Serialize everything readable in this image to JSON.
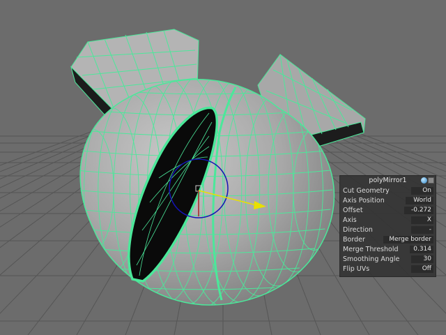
{
  "panel": {
    "title": "polyMirror1",
    "rows": [
      {
        "label": "Cut Geometry",
        "value": "On"
      },
      {
        "label": "Axis Position",
        "value": "World"
      },
      {
        "label": "Offset",
        "value": "-0.272"
      },
      {
        "label": "Axis",
        "value": "X"
      },
      {
        "label": "Direction",
        "value": "-"
      },
      {
        "label": "Border",
        "value": "Merge border"
      },
      {
        "label": "Merge Threshold",
        "value": "0.314"
      },
      {
        "label": "Smoothing Angle",
        "value": "30"
      },
      {
        "label": "Flip UVs",
        "value": "Off"
      }
    ]
  },
  "icons": {
    "help": "help-icon",
    "close": "close-icon"
  },
  "colors": {
    "viewport_bg": "#6c6c6c",
    "grid": "#585858",
    "wireframe": "#4be89a",
    "mesh_fill": "#a2a2a2",
    "manip_circle": "#1414b4",
    "manip_arrow": "#e8e000"
  }
}
